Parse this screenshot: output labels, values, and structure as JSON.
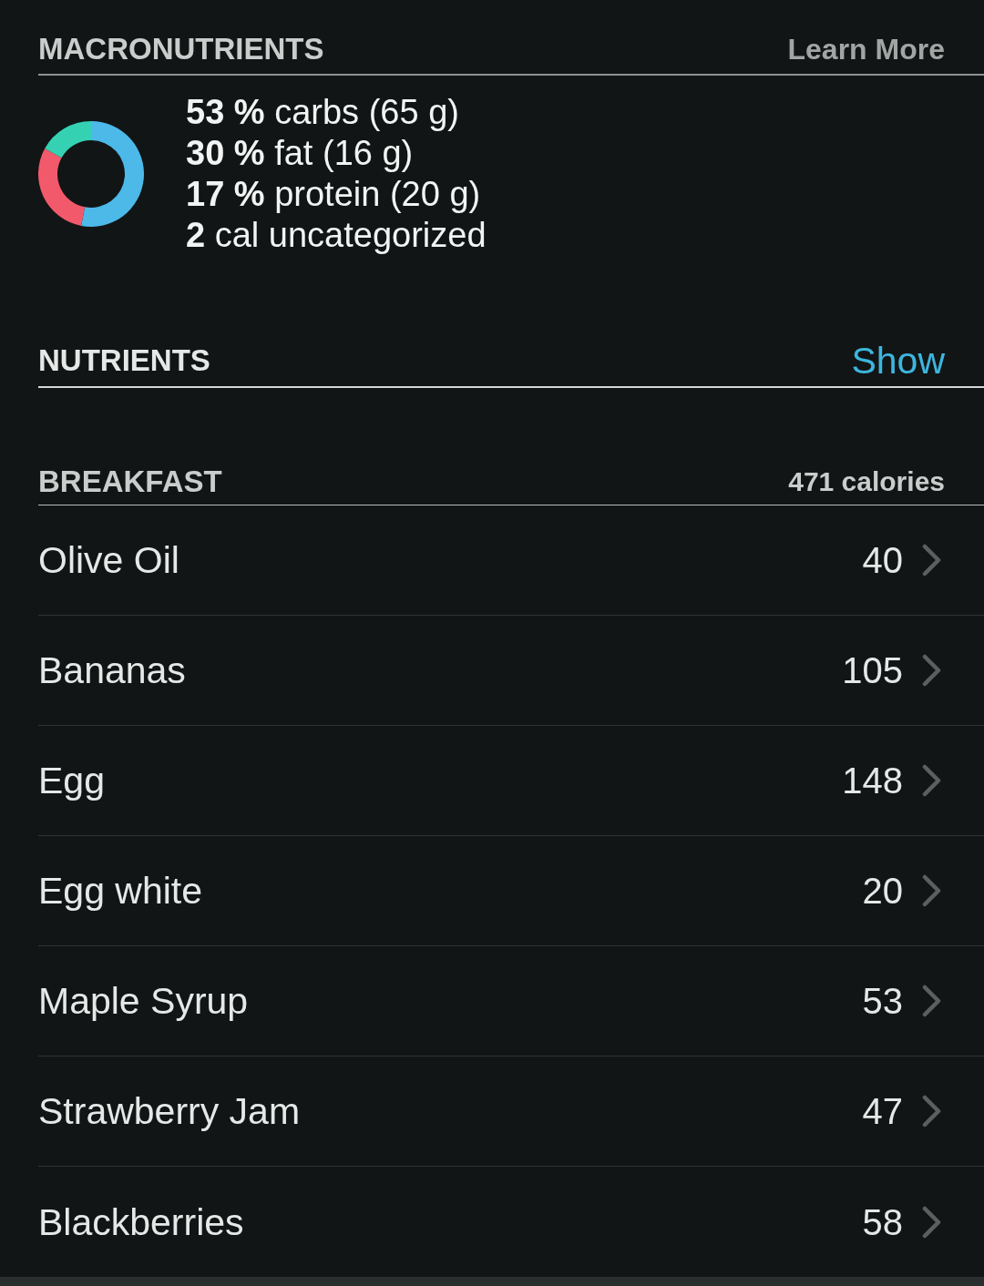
{
  "macronutrients": {
    "title": "MACRONUTRIENTS",
    "link": "Learn More",
    "chart_data": {
      "type": "donut",
      "values": [
        53,
        30,
        17
      ],
      "colors": [
        "#4cb9e9",
        "#f25a6c",
        "#34d2b3"
      ]
    },
    "lines": [
      "**53 %** carbs (65 g)",
      "**30 %** fat (16 g)",
      "**17 %** protein (20 g)",
      "**2** cal uncategorized"
    ]
  },
  "nutrients": {
    "title": "NUTRIENTS",
    "link": "Show"
  },
  "breakfast": {
    "title": "BREAKFAST",
    "total": "471 calories",
    "items": [
      {
        "name": "Olive Oil",
        "calories": "40"
      },
      {
        "name": "Bananas",
        "calories": "105"
      },
      {
        "name": "Egg",
        "calories": "148"
      },
      {
        "name": "Egg white",
        "calories": "20"
      },
      {
        "name": "Maple Syrup",
        "calories": "53"
      },
      {
        "name": "Strawberry Jam",
        "calories": "47"
      },
      {
        "name": "Blackberries",
        "calories": "58"
      }
    ]
  }
}
